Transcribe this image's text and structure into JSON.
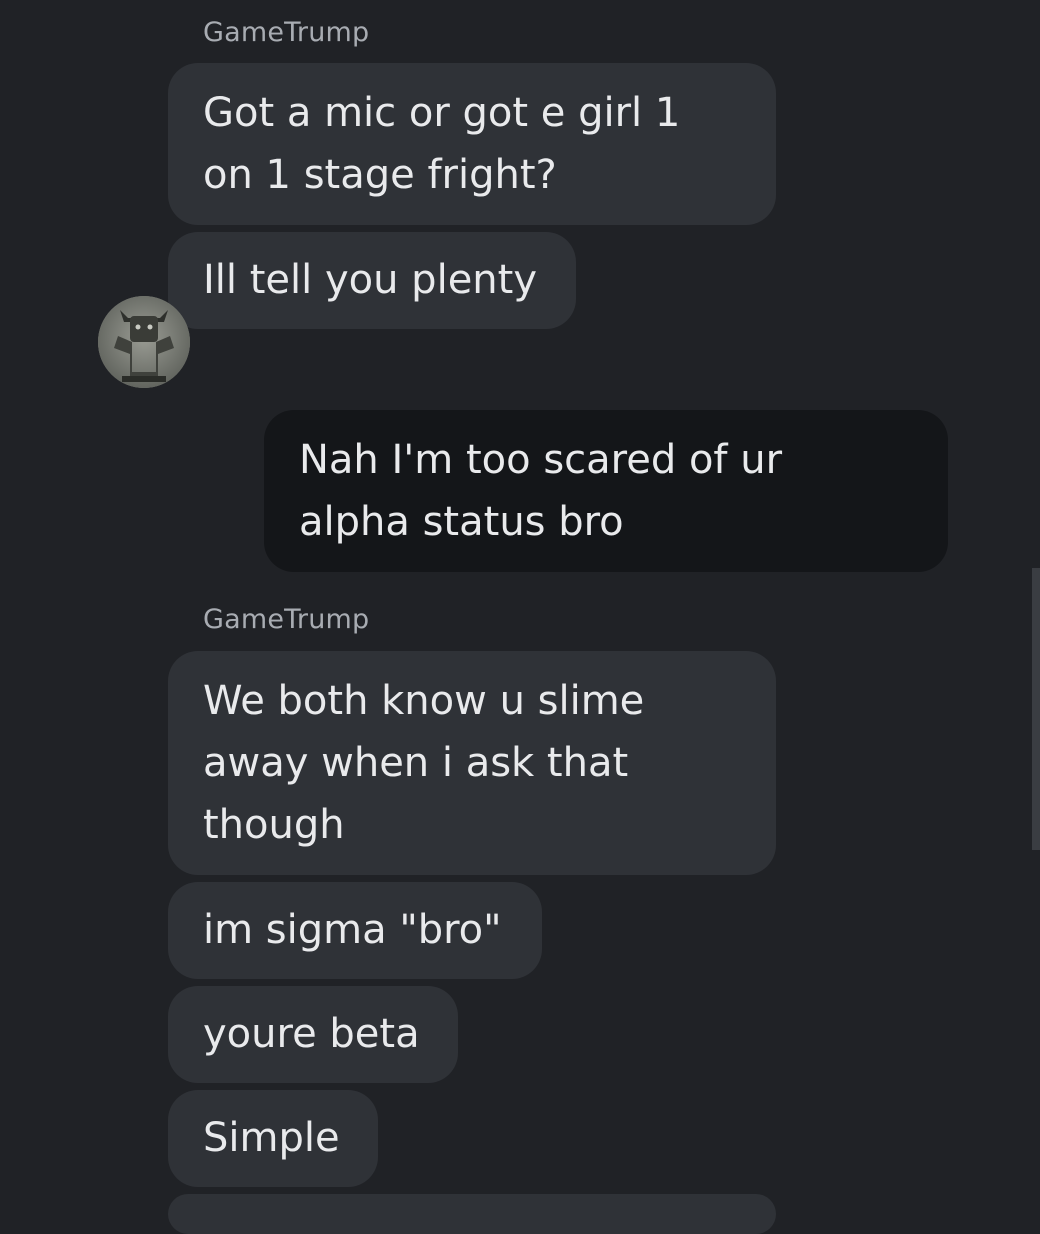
{
  "conversation": {
    "group1": {
      "sender": "GameTrump",
      "messages": [
        "Got a mic or got e girl 1\non 1 stage fright?",
        "Ill tell you plenty"
      ]
    },
    "reply": {
      "text": "Nah I'm too scared of ur\nalpha status bro"
    },
    "group2": {
      "sender": "GameTrump",
      "messages": [
        "We both know u slime\naway when i ask that\nthough",
        "im sigma \"bro\"",
        "youre beta",
        "Simple"
      ]
    }
  },
  "colors": {
    "background": "#202226",
    "incoming_bubble": "#2f3237",
    "outgoing_bubble": "#141619",
    "sender_name": "#a8acb2",
    "message_text": "#e9eaec"
  },
  "icons": {
    "avatar": "avatar-image"
  }
}
